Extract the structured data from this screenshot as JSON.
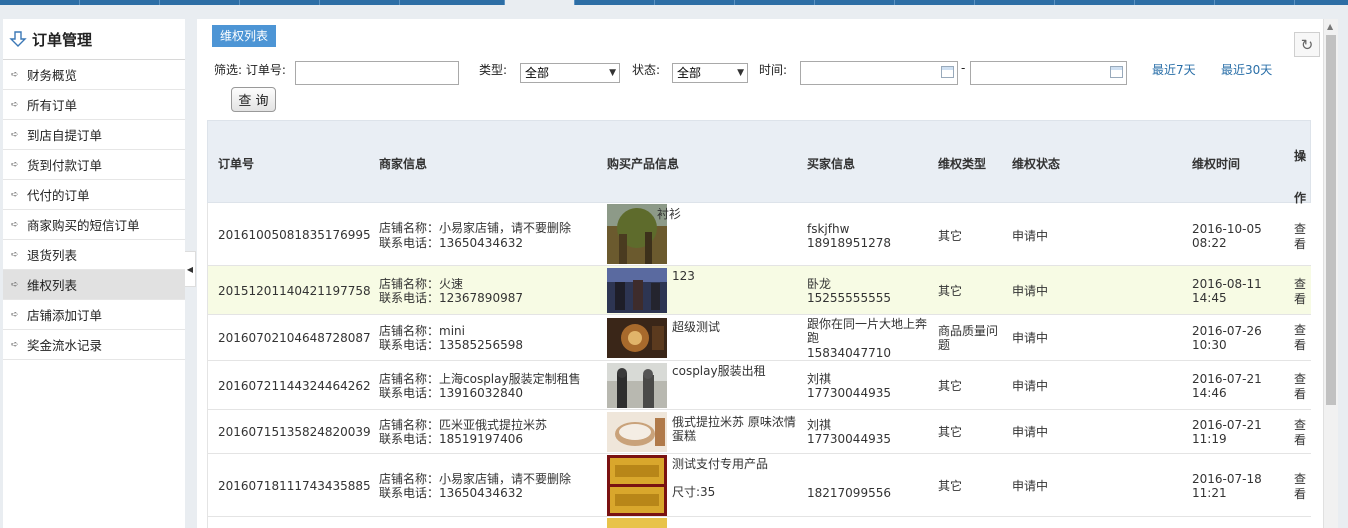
{
  "sidebar": {
    "title": "订单管理",
    "items": [
      {
        "label": "财务概览"
      },
      {
        "label": "所有订单"
      },
      {
        "label": "到店自提订单"
      },
      {
        "label": "货到付款订单"
      },
      {
        "label": "代付的订单"
      },
      {
        "label": "商家购买的短信订单"
      },
      {
        "label": "退货列表"
      },
      {
        "label": "维权列表"
      },
      {
        "label": "店铺添加订单"
      },
      {
        "label": "奖金流水记录"
      }
    ]
  },
  "main": {
    "tab_label": "维权列表",
    "filter": {
      "prefix": "筛选: 订单号:",
      "order_no_value": "",
      "type_label": "类型:",
      "type_value": "全部",
      "status_label": "状态:",
      "status_value": "全部",
      "time_label": "时间:",
      "time_from": "",
      "time_sep": "-",
      "time_to": "",
      "last7": "最近7天",
      "last30": "最近30天",
      "query_button": "查 询"
    },
    "columns": [
      "订单号",
      "商家信息",
      "购买产品信息",
      "买家信息",
      "维权类型",
      "维权状态",
      "维权时间",
      "操作"
    ],
    "op_label": "查看",
    "rows": [
      {
        "order_no": "20161005081835176995",
        "shop_name": "店铺名称：小易家店铺，请不要删除",
        "shop_phone": "联系电话：13650434632",
        "product": "衬衫",
        "product_extra": "",
        "buyer_name": "fskjfhw",
        "buyer_phone": "18918951278",
        "type": "其它",
        "status": "申请中",
        "date": "2016-10-05",
        "time": "08:22"
      },
      {
        "order_no": "20151201140421197758",
        "shop_name": "店铺名称：火速",
        "shop_phone": "联系电话：12367890987",
        "product": "123",
        "product_extra": "",
        "buyer_name": "卧龙",
        "buyer_phone": "15255555555",
        "type": "其它",
        "status": "申请中",
        "date": "2016-08-11",
        "time": "14:45"
      },
      {
        "order_no": "20160702104648728087",
        "shop_name": "店铺名称：mini",
        "shop_phone": "联系电话：13585256598",
        "product": "超级测试",
        "product_extra": "",
        "buyer_name": "跟你在同一片大地上奔跑",
        "buyer_phone": "15834047710",
        "type": "商品质量问题",
        "status": "申请中",
        "date": "2016-07-26",
        "time": "10:30"
      },
      {
        "order_no": "20160721144324464262",
        "shop_name": "店铺名称：上海cosplay服装定制租售",
        "shop_phone": "联系电话：13916032840",
        "product": "cosplay服装出租",
        "product_extra": "",
        "buyer_name": "刘祺",
        "buyer_phone": "17730044935",
        "type": "其它",
        "status": "申请中",
        "date": "2016-07-21",
        "time": "14:46"
      },
      {
        "order_no": "20160715135824820039",
        "shop_name": "店铺名称：匹米亚俄式提拉米苏",
        "shop_phone": "联系电话：18519197406",
        "product": "俄式提拉米苏 原味浓情蛋糕",
        "product_extra": "",
        "buyer_name": "刘祺",
        "buyer_phone": "17730044935",
        "type": "其它",
        "status": "申请中",
        "date": "2016-07-21",
        "time": "11:19"
      },
      {
        "order_no": "20160718111743435885",
        "shop_name": "店铺名称：小易家店铺，请不要删除",
        "shop_phone": "联系电话：13650434632",
        "product": "测试支付专用产品",
        "product_extra": "尺寸:35",
        "buyer_name": "",
        "buyer_phone": "18217099556",
        "type": "其它",
        "status": "申请中",
        "date": "2016-07-18",
        "time": "11:21"
      }
    ]
  }
}
